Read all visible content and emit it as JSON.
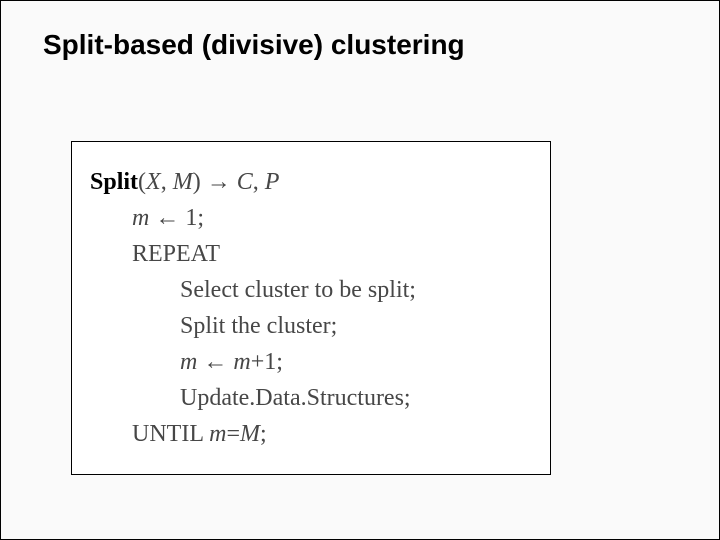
{
  "title": "Split-based (divisive) clustering",
  "algo": {
    "func_name": "Split",
    "args_open": "(",
    "arg1": "X",
    "comma1": ", ",
    "arg2": "M",
    "args_close": ")",
    "arrow": " → ",
    "ret1": "C",
    "comma2": ", ",
    "ret2": "P",
    "line1_lhs": "m",
    "line1_rest": " ← 1;",
    "line2": "REPEAT",
    "line3": "Select cluster to be split;",
    "line4": "Split the cluster;",
    "line5_lhs": "m",
    "line5_mid": " ← ",
    "line5_rhs": "m",
    "line5_end": "+1;",
    "line6": "Update.Data.Structures;",
    "line7_pre": "UNTIL ",
    "line7_lhs": "m",
    "line7_eq": "=",
    "line7_rhs": "M",
    "line7_end": ";"
  }
}
